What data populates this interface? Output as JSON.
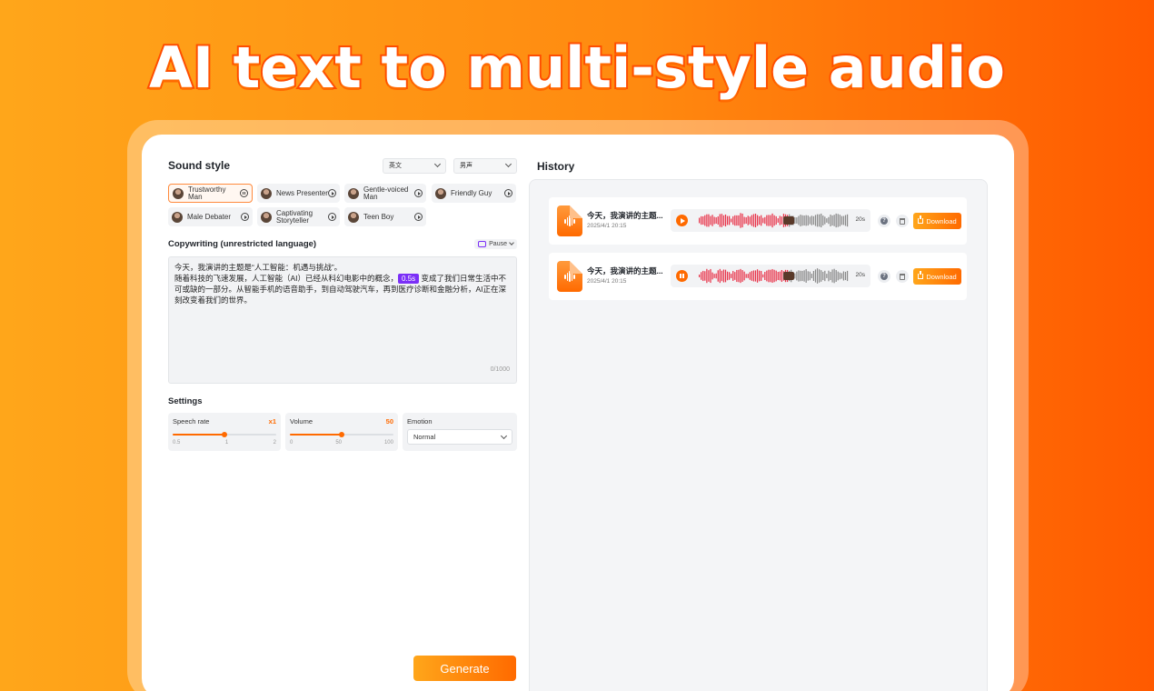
{
  "hero": {
    "title": "AI text to multi-style audio"
  },
  "sound_style": {
    "title": "Sound style",
    "language_select": "英文",
    "gender_select": "男声",
    "voices": [
      {
        "label": "Trustworthy Man",
        "state": "paused"
      },
      {
        "label": "News Presenter",
        "state": "play"
      },
      {
        "label": "Gentle-voiced Man",
        "state": "play"
      },
      {
        "label": "Friendly Guy",
        "state": "play"
      },
      {
        "label": "Male Debater",
        "state": "play"
      },
      {
        "label": "Captivating Storyteller",
        "state": "play"
      },
      {
        "label": "Teen Boy",
        "state": "play"
      }
    ]
  },
  "copywriting": {
    "title": "Copywriting (unrestricted language)",
    "pause_label": "Pause",
    "text_line1": "今天，我演讲的主题是“人工智能：机遇与挑战”。",
    "text_part_a": "随着科技的飞速发展，人工智能（AI）已经从科幻电影中的概念，",
    "pause_tag": "0.5s",
    "text_part_b": " 变成了我们日常生活中不可或缺的一部分。从智能手机的语音助手，到自动驾驶汽车，再到医疗诊断和金融分析，AI正在深刻改变着我们的世界。",
    "counter": "0/1000"
  },
  "settings": {
    "title": "Settings",
    "speech_rate": {
      "label": "Speech rate",
      "value": "x1",
      "level": 0.5,
      "ticks": [
        "0.5",
        "1",
        "2"
      ]
    },
    "volume": {
      "label": "Volume",
      "value": "50",
      "level": 0.5,
      "ticks": [
        "0",
        "50",
        "100"
      ]
    },
    "emotion": {
      "label": "Emotion",
      "value": "Normal"
    }
  },
  "generate_label": "Generate",
  "history": {
    "title": "History",
    "items": [
      {
        "name": "今天，我演讲的主题...",
        "date": "2025/4/1 20:15",
        "duration": "20s",
        "state": "play",
        "progress": 0.6,
        "download_label": "Download"
      },
      {
        "name": "今天，我演讲的主题...",
        "date": "2025/4/1 20:15",
        "duration": "20s",
        "state": "pause",
        "progress": 0.6,
        "download_label": "Download"
      }
    ]
  },
  "colors": {
    "accent": "#ff6a00",
    "wave_played": "#e8344a",
    "wave_unplayed": "#8a8a8a",
    "pause_tag": "#7b2ff7"
  }
}
